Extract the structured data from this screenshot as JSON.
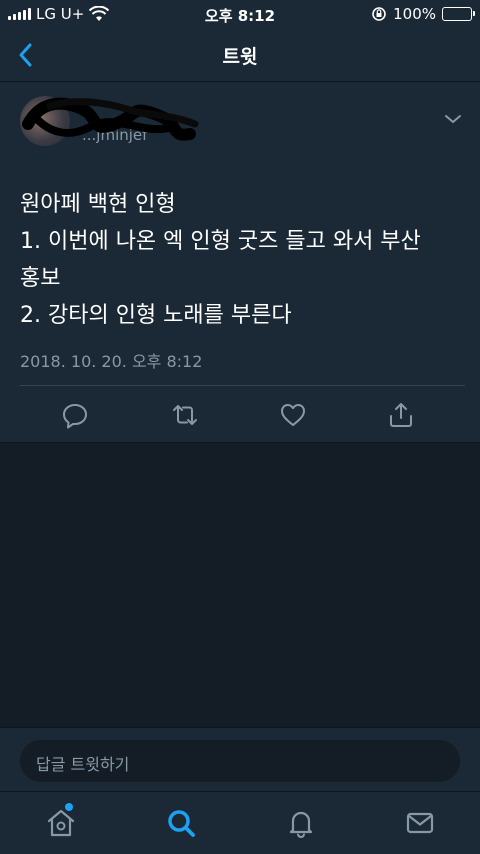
{
  "status_bar": {
    "carrier": "LG U+",
    "time": "오후 8:12",
    "battery": "100%",
    "battery_level": 1.0
  },
  "nav": {
    "title": "트윗",
    "back_icon": "chevron-left-icon"
  },
  "tweet": {
    "handle": "...jminjef",
    "text_lines": [
      "원아페 백현 인형",
      "1. 이번에 나온 엑 인형 굿즈 들고 와서 부산",
      "홍보",
      "2. 강타의 인형 노래를 부른다"
    ],
    "timestamp": "2018. 10. 20. 오후 8:12",
    "actions": [
      "reply-icon",
      "retweet-icon",
      "like-icon",
      "share-icon"
    ]
  },
  "reply": {
    "placeholder": "답글 트윗하기"
  },
  "tabs": [
    "home-icon",
    "search-icon",
    "notifications-icon",
    "messages-icon"
  ],
  "colors": {
    "accent": "#1da1f2",
    "background": "#141d26",
    "surface": "#1b2836",
    "secondary_text": "#8899a6",
    "battery": "#f5c518"
  }
}
